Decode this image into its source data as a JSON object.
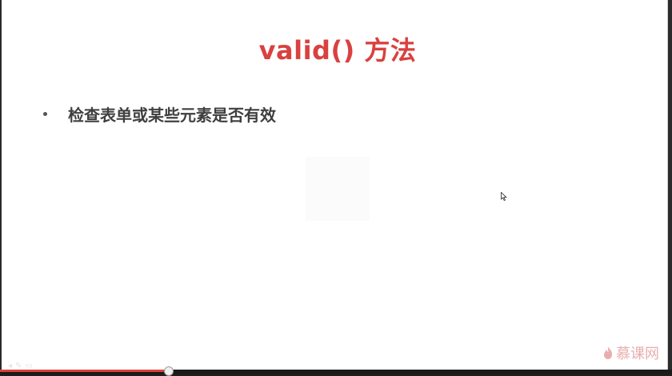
{
  "slide": {
    "title": "valid() 方法",
    "bullets": [
      {
        "text": "检查表单或某些元素是否有效"
      }
    ]
  },
  "nav": {
    "icons": [
      "prev-icon",
      "pen-icon",
      "menu-icon"
    ]
  },
  "player": {
    "progress_fraction": 0.25
  },
  "watermark": {
    "text": "慕课网"
  },
  "colors": {
    "title": "#d9413f",
    "bullet_text": "#3f3f3f",
    "progress": "#d9413f"
  }
}
